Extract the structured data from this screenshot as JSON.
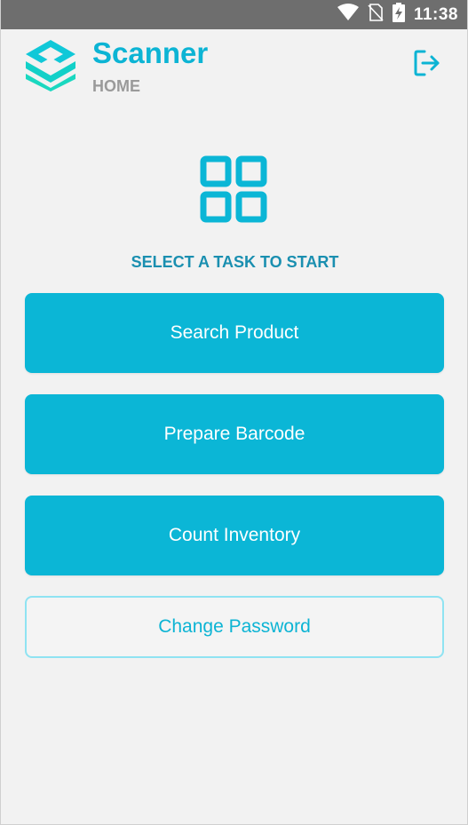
{
  "status_bar": {
    "time": "11:38",
    "icons": [
      "wifi-icon",
      "no-sim-icon",
      "battery-charging-icon"
    ]
  },
  "header": {
    "title": "Scanner",
    "subtitle": "HOME",
    "logo_icon": "layers-logo-icon",
    "logout_icon": "logout-icon"
  },
  "main": {
    "center_icon": "grid-apps-icon",
    "prompt": "SELECT A TASK TO START",
    "buttons": [
      {
        "label": "Search Product"
      },
      {
        "label": "Prepare Barcode"
      },
      {
        "label": "Count Inventory"
      }
    ],
    "secondary_button": {
      "label": "Change Password"
    }
  },
  "colors": {
    "accent": "#0bb6d6",
    "prompt_text": "#1a8fb0",
    "subtitle_text": "#9a9a9a",
    "outline_border": "#8fe3f2",
    "status_bar_bg": "#6e6e6e",
    "background": "#f2f2f2"
  }
}
